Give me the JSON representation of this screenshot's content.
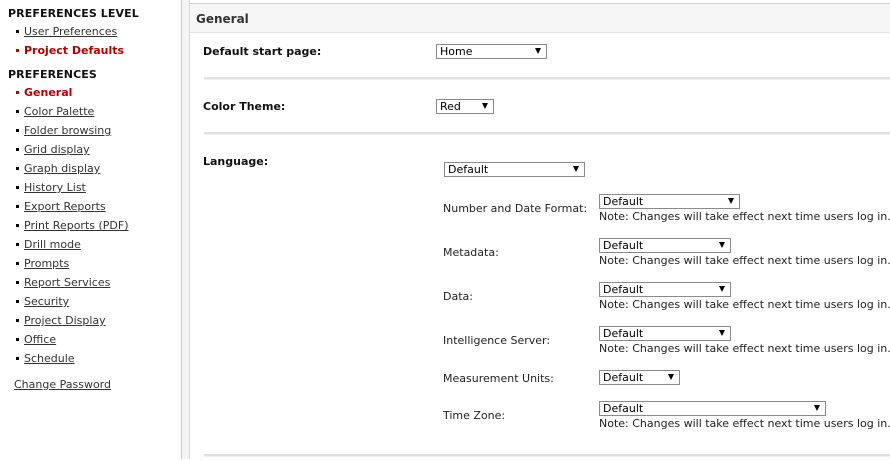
{
  "sidebar": {
    "level_heading": "PREFERENCES LEVEL",
    "level_items": [
      {
        "label": "User Preferences",
        "active": false
      },
      {
        "label": "Project Defaults",
        "active": true
      }
    ],
    "prefs_heading": "PREFERENCES",
    "pref_items": [
      {
        "label": "General",
        "active": true
      },
      {
        "label": "Color Palette",
        "active": false
      },
      {
        "label": "Folder browsing",
        "active": false
      },
      {
        "label": "Grid display",
        "active": false
      },
      {
        "label": "Graph display",
        "active": false
      },
      {
        "label": "History List",
        "active": false
      },
      {
        "label": "Export Reports",
        "active": false
      },
      {
        "label": "Print Reports (PDF)",
        "active": false
      },
      {
        "label": "Drill mode",
        "active": false
      },
      {
        "label": "Prompts",
        "active": false
      },
      {
        "label": "Report Services",
        "active": false
      },
      {
        "label": "Security",
        "active": false
      },
      {
        "label": "Project Display",
        "active": false
      },
      {
        "label": "Office",
        "active": false
      },
      {
        "label": "Schedule",
        "active": false
      }
    ],
    "change_password": "Change Password"
  },
  "main": {
    "section_title": "General",
    "start_page": {
      "label": "Default start page:",
      "value": "Home"
    },
    "color_theme": {
      "label": "Color Theme:",
      "value": "Red"
    },
    "language": {
      "label": "Language:",
      "value": "Default",
      "sub": [
        {
          "label": "Number and Date Format:",
          "value": "Default",
          "note": "Note: Changes will take effect next time users log in."
        },
        {
          "label": "Metadata:",
          "value": "Default",
          "note": "Note: Changes will take effect next time users log in."
        },
        {
          "label": "Data:",
          "value": "Default",
          "note": "Note: Changes will take effect next time users log in."
        },
        {
          "label": "Intelligence Server:",
          "value": "Default",
          "note": "Note: Changes will take effect next time users log in."
        },
        {
          "label": "Measurement Units:",
          "value": "Default",
          "note": ""
        },
        {
          "label": "Time Zone:",
          "value": "Default",
          "note": "Note: Changes will take effect next time users log in."
        }
      ]
    }
  },
  "colors": {
    "active_link": "#b00000",
    "link": "#333333"
  }
}
